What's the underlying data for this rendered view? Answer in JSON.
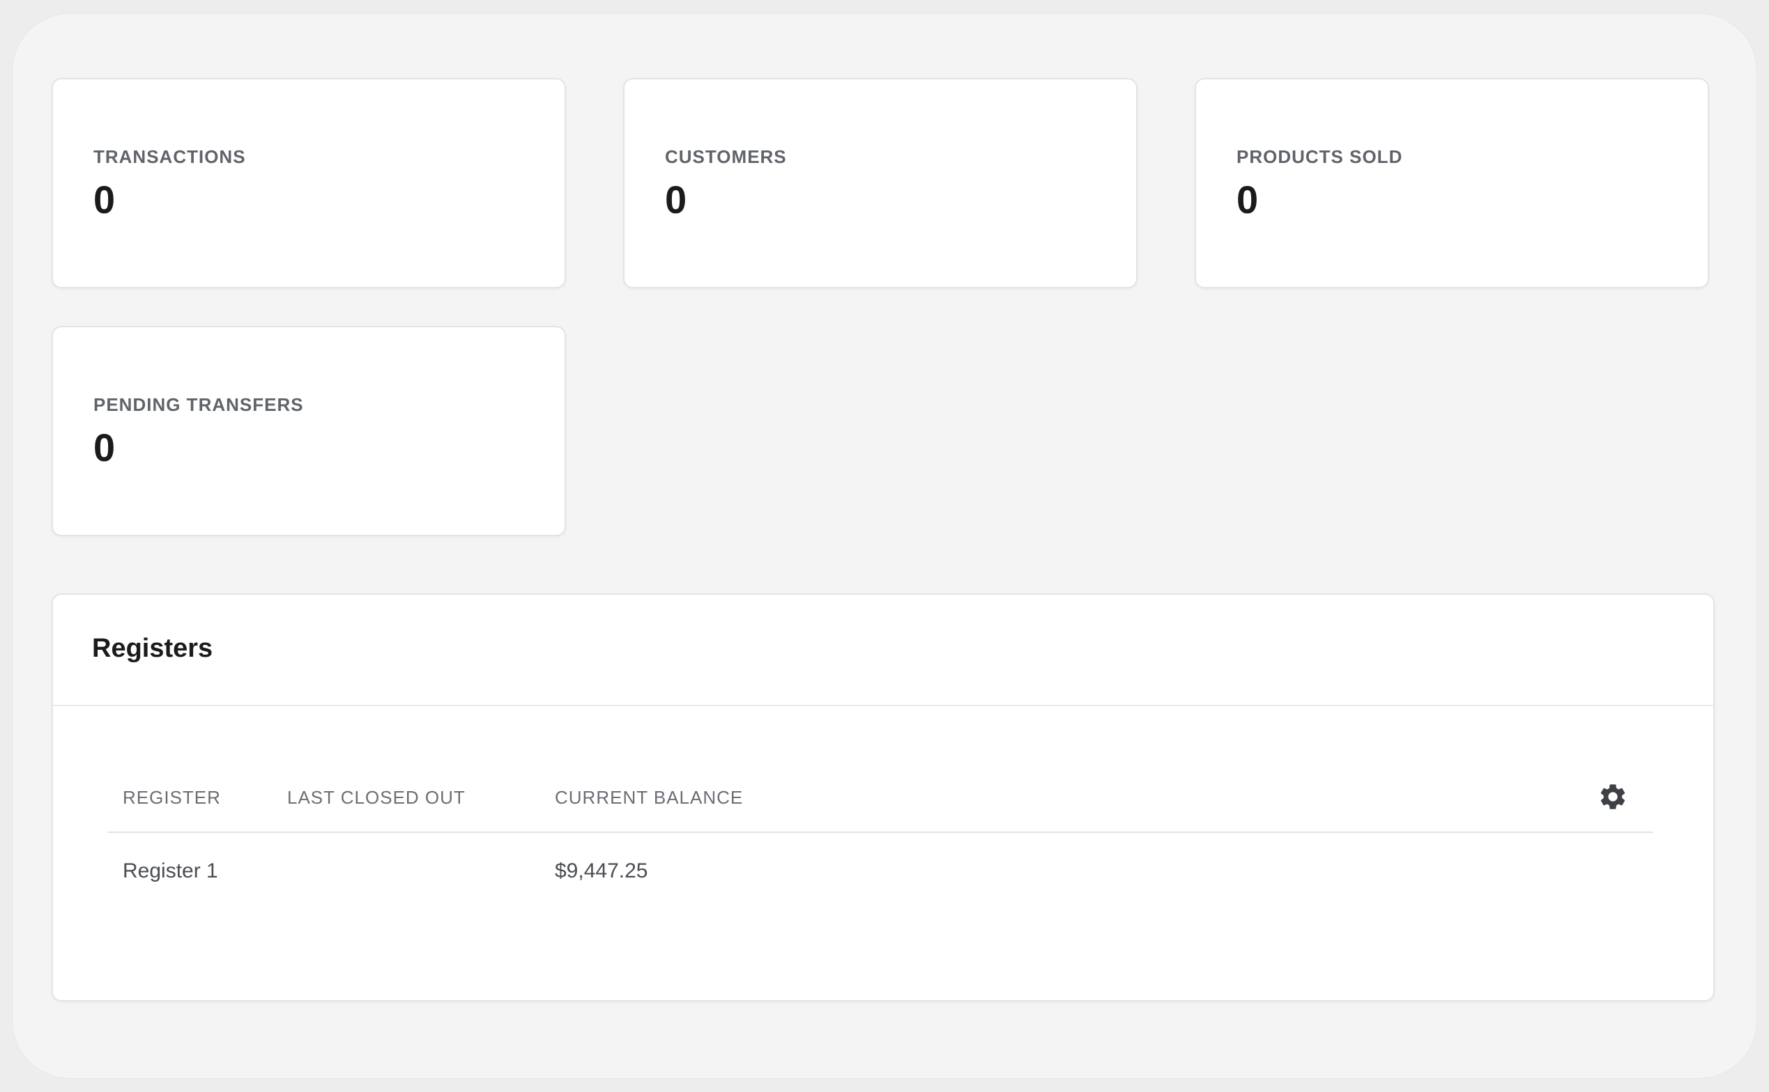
{
  "stats": [
    {
      "label": "TRANSACTIONS",
      "value": "0"
    },
    {
      "label": "CUSTOMERS",
      "value": "0"
    },
    {
      "label": "PRODUCTS SOLD",
      "value": "0"
    },
    {
      "label": "PENDING TRANSFERS",
      "value": "0"
    }
  ],
  "registers": {
    "title": "Registers",
    "columns": {
      "register": "REGISTER",
      "last_closed_out": "LAST CLOSED OUT",
      "current_balance": "CURRENT BALANCE"
    },
    "rows": [
      {
        "register": "Register 1",
        "last_closed_out": "",
        "current_balance": "$9,447.25"
      }
    ],
    "settings_icon": "gear-icon"
  }
}
